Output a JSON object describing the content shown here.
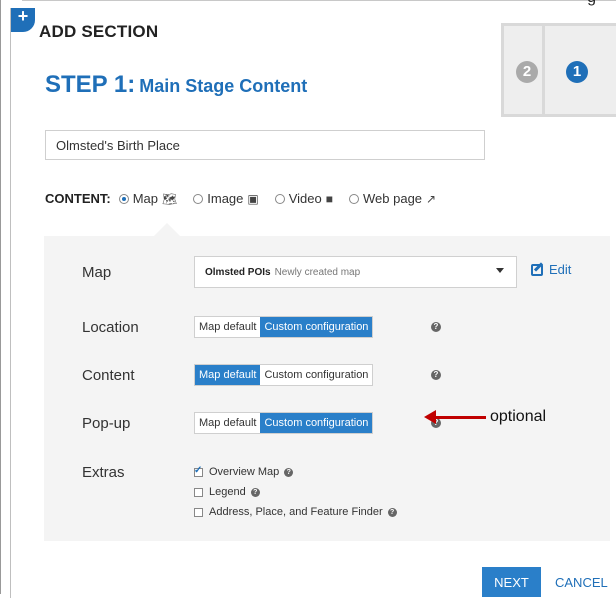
{
  "header": {
    "partial_top_text": "g",
    "dialog_title": "ADD SECTION",
    "plus_symbol": "+"
  },
  "step": {
    "label": "STEP 1:",
    "title": "Main Stage Content",
    "indicators": [
      "2",
      "1"
    ],
    "active_indicator": "1"
  },
  "title_input": {
    "value": "Olmsted's Birth Place"
  },
  "content": {
    "label": "CONTENT:",
    "options": [
      {
        "label": "Map",
        "icon": "map-icon",
        "checked": true
      },
      {
        "label": "Image",
        "icon": "camera-icon",
        "checked": false
      },
      {
        "label": "Video",
        "icon": "video-icon",
        "checked": false
      },
      {
        "label": "Web page",
        "icon": "external-link-icon",
        "checked": false
      }
    ]
  },
  "panel": {
    "map": {
      "label": "Map",
      "selected_name": "Olmsted POIs",
      "selected_sub": "Newly created map",
      "edit_label": "Edit"
    },
    "location": {
      "label": "Location",
      "options": [
        "Map default",
        "Custom configuration"
      ],
      "active": "Custom configuration"
    },
    "content": {
      "label": "Content",
      "options": [
        "Map default",
        "Custom configuration"
      ],
      "active": "Map default"
    },
    "popup": {
      "label": "Pop-up",
      "options": [
        "Map default",
        "Custom configuration"
      ],
      "active": "Custom configuration"
    },
    "extras": {
      "label": "Extras",
      "items": [
        {
          "label": "Overview Map",
          "checked": true
        },
        {
          "label": "Legend",
          "checked": false
        },
        {
          "label": "Address, Place, and Feature Finder",
          "checked": false
        }
      ]
    }
  },
  "annotation": {
    "text": "optional"
  },
  "footer": {
    "next": "NEXT",
    "cancel": "CANCEL"
  },
  "colors": {
    "accent": "#1f6fb8",
    "active_toggle": "#2a7fc9",
    "annotation": "#c00000",
    "panel_bg": "#f4f4f4"
  }
}
